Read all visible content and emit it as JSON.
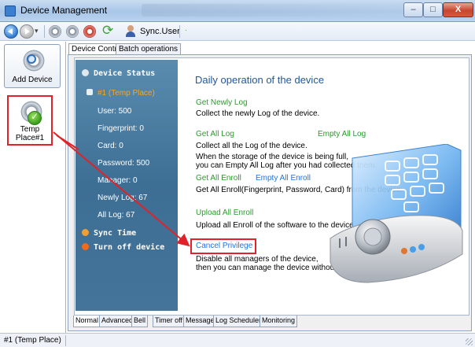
{
  "window": {
    "title": "Device Management",
    "controls": {
      "minimize": "–",
      "maximize": "□",
      "close": "X"
    }
  },
  "toolbar": {
    "sync_user_label": "Sync.User",
    "icons": [
      "back-icon",
      "forward-icon",
      "gear-icon",
      "gear-icon",
      "gear-icon",
      "sync-icon",
      "user-icon"
    ]
  },
  "left_panel": {
    "add_device_label": "Add Device",
    "device_item_label_line1": "Temp",
    "device_item_label_line2": "Place#1"
  },
  "top_tabs": [
    {
      "label": "Device Control",
      "active": true
    },
    {
      "label": "Batch operations",
      "active": false
    }
  ],
  "status_panel": {
    "device_status_heading": "Device Status",
    "place": "#1 (Temp Place)",
    "stats": [
      "User: 500",
      "Fingerprint: 0",
      "Card: 0",
      "Password: 500",
      "Manager: 0",
      "Newly Log: 67",
      "All Log: 67"
    ],
    "sync_time": "Sync Time",
    "turn_off": "Turn off device"
  },
  "content": {
    "title": "Daily operation of the device",
    "get_newly_log": "Get Newly Log",
    "get_newly_log_desc": "Collect the newly Log of the device.",
    "get_all_log": "Get All Log",
    "empty_all_log": "Empty All Log",
    "get_all_log_desc1": "Collect all the Log of the device.",
    "get_all_log_desc2": "When the storage of the device is being full,",
    "get_all_log_desc3": "you can Empty All Log after you had collected them.",
    "get_all_enroll": "Get All Enroll",
    "empty_all_enroll": "Empty All Enroll",
    "get_all_enroll_desc": "Get All Enroll(Fingerprint, Password, Card) from the device.",
    "upload_all_enroll": "Upload All Enroll",
    "upload_all_enroll_desc": "Upload all Enroll of the software to the device.",
    "cancel_privilege": "Cancel Privilege",
    "cancel_privilege_desc1": "Disable all managers of the device,",
    "cancel_privilege_desc2": "then you can manage the device without manager."
  },
  "bottom_tabs": [
    {
      "label": "Normal",
      "active": true
    },
    {
      "label": "Advanced",
      "active": false
    },
    {
      "label": "Bell",
      "active": false
    },
    {
      "label": "Timer off",
      "active": false
    },
    {
      "label": "Message",
      "active": false
    },
    {
      "label": "Log Scheduler",
      "active": false
    },
    {
      "label": "Monitoring",
      "active": false
    }
  ],
  "statusbar": {
    "text": "#1 (Temp Place)"
  },
  "colors": {
    "accent": "#2256a0",
    "link_green": "#2a9a2a",
    "link_blue": "#2176d8",
    "highlight_red": "#e0232a",
    "panel": "#3d6e93"
  }
}
